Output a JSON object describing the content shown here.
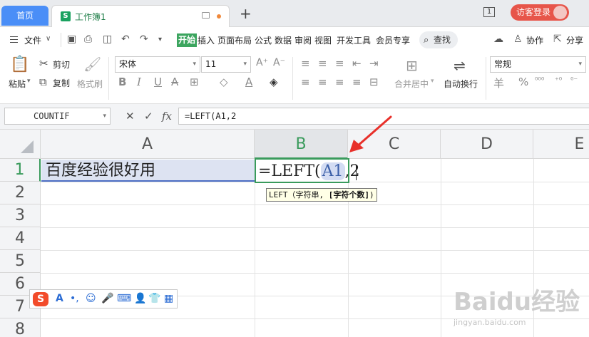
{
  "tabbar": {
    "home_tab": "首页",
    "workbook_icon": "S",
    "workbook_title": "工作簿1",
    "new_tab": "+",
    "window_count": "1",
    "visitor_login": "访客登录"
  },
  "menu": {
    "file": "文件",
    "start": "开始",
    "items": [
      "插入",
      "页面布局",
      "公式",
      "数据",
      "审阅",
      "视图",
      "开发工具",
      "会员专享"
    ],
    "search": "查找",
    "collaborate": "协作",
    "share": "分享"
  },
  "ribbon": {
    "paste": "粘贴",
    "cut": "剪切",
    "copy": "复制",
    "format_painter": "格式刷",
    "font_name": "宋体",
    "font_size": "11",
    "merge_center": "合并居中",
    "auto_wrap": "自动换行",
    "number_format": "常规",
    "percent_symbol": "%",
    "currency_symbol": "羊"
  },
  "formula_bar": {
    "name_box": "COUNTIF",
    "formula": "=LEFT(A1,2"
  },
  "grid": {
    "columns": [
      "A",
      "B",
      "C",
      "D",
      "E"
    ],
    "rows": [
      "1",
      "2",
      "3",
      "4",
      "5",
      "6",
      "7",
      "8"
    ],
    "cell_a1": "百度经验很好用",
    "cell_b1_prefix": "=LEFT(",
    "cell_b1_ref": "A1",
    "cell_b1_suffix": ",2",
    "tooltip_fn": "LEFT（字符串,",
    "tooltip_arg": "[字符个数]",
    "tooltip_close": ")"
  },
  "ime": {
    "logo": "S",
    "items": [
      "A",
      "•,",
      "☺",
      "🎤",
      "⌨",
      "👤",
      "👕",
      "▦"
    ]
  },
  "watermark": {
    "main": "Baidu经验",
    "sub": "jingyan.baidu.com"
  },
  "colors": {
    "accent_green": "#3a9b5c",
    "home_blue": "#4a8ef7",
    "visitor_red": "#e7554a",
    "annotation_arrow": "#e8302a"
  }
}
